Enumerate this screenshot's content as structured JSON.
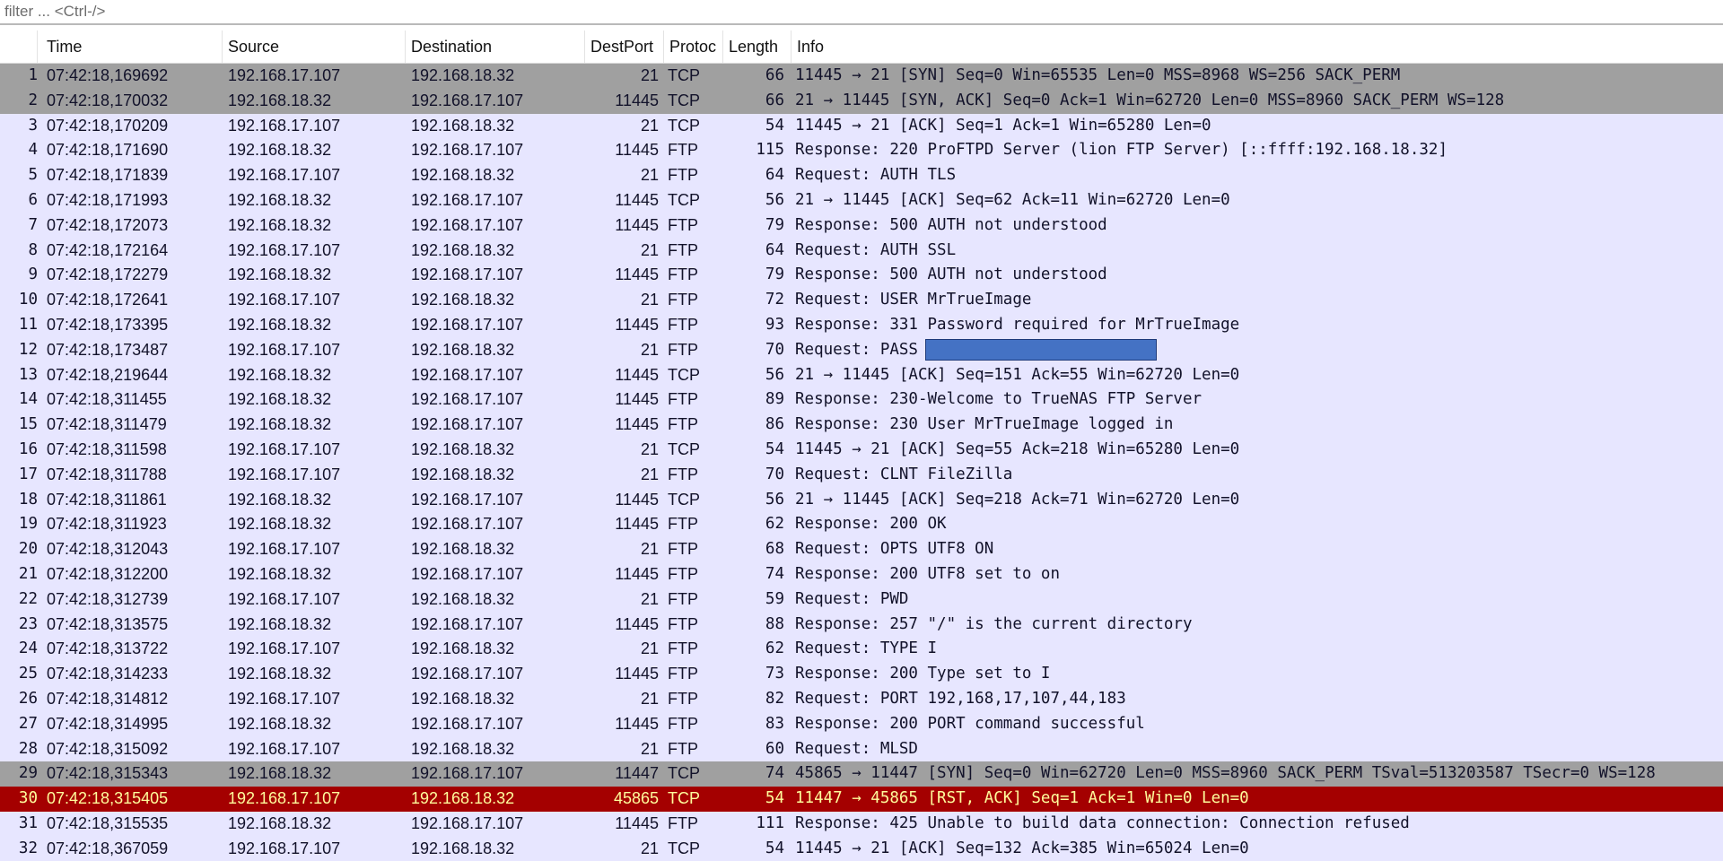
{
  "filter": {
    "placeholder": "filter ... <Ctrl-/>"
  },
  "columns": {
    "no": "",
    "time": "Time",
    "source": "Source",
    "destination": "Destination",
    "destport": "DestPort",
    "protocol": "Protoc",
    "length": "Length",
    "info": "Info"
  },
  "colors": {
    "tcp_ftp_row": "#e7e6ff",
    "syn_row": "#a0a0a0",
    "rst_row": "#a40000",
    "rst_text": "#fffc9c",
    "redaction": "#4472c4"
  },
  "rows": [
    {
      "no": "1",
      "time": "07:42:18,169692",
      "src": "192.168.17.107",
      "dst": "192.168.18.32",
      "dport": "21",
      "proto": "TCP",
      "len": "66",
      "info": "11445 → 21 [SYN] Seq=0 Win=65535 Len=0 MSS=8968 WS=256 SACK_PERM",
      "style": "syn"
    },
    {
      "no": "2",
      "time": "07:42:18,170032",
      "src": "192.168.18.32",
      "dst": "192.168.17.107",
      "dport": "11445",
      "proto": "TCP",
      "len": "66",
      "info": "21 → 11445 [SYN, ACK] Seq=0 Ack=1 Win=62720 Len=0 MSS=8960 SACK_PERM WS=128",
      "style": "syn"
    },
    {
      "no": "3",
      "time": "07:42:18,170209",
      "src": "192.168.17.107",
      "dst": "192.168.18.32",
      "dport": "21",
      "proto": "TCP",
      "len": "54",
      "info": "11445 → 21 [ACK] Seq=1 Ack=1 Win=65280 Len=0",
      "style": "tcp"
    },
    {
      "no": "4",
      "time": "07:42:18,171690",
      "src": "192.168.18.32",
      "dst": "192.168.17.107",
      "dport": "11445",
      "proto": "FTP",
      "len": "115",
      "info": "Response: 220 ProFTPD Server (lion FTP Server) [::ffff:192.168.18.32]",
      "style": "ftp"
    },
    {
      "no": "5",
      "time": "07:42:18,171839",
      "src": "192.168.17.107",
      "dst": "192.168.18.32",
      "dport": "21",
      "proto": "FTP",
      "len": "64",
      "info": "Request: AUTH TLS",
      "style": "ftp"
    },
    {
      "no": "6",
      "time": "07:42:18,171993",
      "src": "192.168.18.32",
      "dst": "192.168.17.107",
      "dport": "11445",
      "proto": "TCP",
      "len": "56",
      "info": "21 → 11445 [ACK] Seq=62 Ack=11 Win=62720 Len=0",
      "style": "tcp"
    },
    {
      "no": "7",
      "time": "07:42:18,172073",
      "src": "192.168.18.32",
      "dst": "192.168.17.107",
      "dport": "11445",
      "proto": "FTP",
      "len": "79",
      "info": "Response: 500 AUTH not understood",
      "style": "ftp"
    },
    {
      "no": "8",
      "time": "07:42:18,172164",
      "src": "192.168.17.107",
      "dst": "192.168.18.32",
      "dport": "21",
      "proto": "FTP",
      "len": "64",
      "info": "Request: AUTH SSL",
      "style": "ftp"
    },
    {
      "no": "9",
      "time": "07:42:18,172279",
      "src": "192.168.18.32",
      "dst": "192.168.17.107",
      "dport": "11445",
      "proto": "FTP",
      "len": "79",
      "info": "Response: 500 AUTH not understood",
      "style": "ftp"
    },
    {
      "no": "10",
      "time": "07:42:18,172641",
      "src": "192.168.17.107",
      "dst": "192.168.18.32",
      "dport": "21",
      "proto": "FTP",
      "len": "72",
      "info": "Request: USER MrTrueImage",
      "style": "ftp"
    },
    {
      "no": "11",
      "time": "07:42:18,173395",
      "src": "192.168.18.32",
      "dst": "192.168.17.107",
      "dport": "11445",
      "proto": "FTP",
      "len": "93",
      "info": "Response: 331 Password required for MrTrueImage",
      "style": "ftp"
    },
    {
      "no": "12",
      "time": "07:42:18,173487",
      "src": "192.168.17.107",
      "dst": "192.168.18.32",
      "dport": "21",
      "proto": "FTP",
      "len": "70",
      "info": "Request: PASS",
      "style": "ftp",
      "redacted": true
    },
    {
      "no": "13",
      "time": "07:42:18,219644",
      "src": "192.168.18.32",
      "dst": "192.168.17.107",
      "dport": "11445",
      "proto": "TCP",
      "len": "56",
      "info": "21 → 11445 [ACK] Seq=151 Ack=55 Win=62720 Len=0",
      "style": "tcp"
    },
    {
      "no": "14",
      "time": "07:42:18,311455",
      "src": "192.168.18.32",
      "dst": "192.168.17.107",
      "dport": "11445",
      "proto": "FTP",
      "len": "89",
      "info": "Response: 230-Welcome to TrueNAS FTP Server",
      "style": "ftp"
    },
    {
      "no": "15",
      "time": "07:42:18,311479",
      "src": "192.168.18.32",
      "dst": "192.168.17.107",
      "dport": "11445",
      "proto": "FTP",
      "len": "86",
      "info": "Response: 230 User MrTrueImage logged in",
      "style": "ftp"
    },
    {
      "no": "16",
      "time": "07:42:18,311598",
      "src": "192.168.17.107",
      "dst": "192.168.18.32",
      "dport": "21",
      "proto": "TCP",
      "len": "54",
      "info": "11445 → 21 [ACK] Seq=55 Ack=218 Win=65280 Len=0",
      "style": "tcp"
    },
    {
      "no": "17",
      "time": "07:42:18,311788",
      "src": "192.168.17.107",
      "dst": "192.168.18.32",
      "dport": "21",
      "proto": "FTP",
      "len": "70",
      "info": "Request: CLNT FileZilla",
      "style": "ftp"
    },
    {
      "no": "18",
      "time": "07:42:18,311861",
      "src": "192.168.18.32",
      "dst": "192.168.17.107",
      "dport": "11445",
      "proto": "TCP",
      "len": "56",
      "info": "21 → 11445 [ACK] Seq=218 Ack=71 Win=62720 Len=0",
      "style": "tcp"
    },
    {
      "no": "19",
      "time": "07:42:18,311923",
      "src": "192.168.18.32",
      "dst": "192.168.17.107",
      "dport": "11445",
      "proto": "FTP",
      "len": "62",
      "info": "Response: 200 OK",
      "style": "ftp"
    },
    {
      "no": "20",
      "time": "07:42:18,312043",
      "src": "192.168.17.107",
      "dst": "192.168.18.32",
      "dport": "21",
      "proto": "FTP",
      "len": "68",
      "info": "Request: OPTS UTF8 ON",
      "style": "ftp"
    },
    {
      "no": "21",
      "time": "07:42:18,312200",
      "src": "192.168.18.32",
      "dst": "192.168.17.107",
      "dport": "11445",
      "proto": "FTP",
      "len": "74",
      "info": "Response: 200 UTF8 set to on",
      "style": "ftp"
    },
    {
      "no": "22",
      "time": "07:42:18,312739",
      "src": "192.168.17.107",
      "dst": "192.168.18.32",
      "dport": "21",
      "proto": "FTP",
      "len": "59",
      "info": "Request: PWD",
      "style": "ftp"
    },
    {
      "no": "23",
      "time": "07:42:18,313575",
      "src": "192.168.18.32",
      "dst": "192.168.17.107",
      "dport": "11445",
      "proto": "FTP",
      "len": "88",
      "info": "Response: 257 \"/\" is the current directory",
      "style": "ftp"
    },
    {
      "no": "24",
      "time": "07:42:18,313722",
      "src": "192.168.17.107",
      "dst": "192.168.18.32",
      "dport": "21",
      "proto": "FTP",
      "len": "62",
      "info": "Request: TYPE I",
      "style": "ftp"
    },
    {
      "no": "25",
      "time": "07:42:18,314233",
      "src": "192.168.18.32",
      "dst": "192.168.17.107",
      "dport": "11445",
      "proto": "FTP",
      "len": "73",
      "info": "Response: 200 Type set to I",
      "style": "ftp"
    },
    {
      "no": "26",
      "time": "07:42:18,314812",
      "src": "192.168.17.107",
      "dst": "192.168.18.32",
      "dport": "21",
      "proto": "FTP",
      "len": "82",
      "info": "Request: PORT 192,168,17,107,44,183",
      "style": "ftp"
    },
    {
      "no": "27",
      "time": "07:42:18,314995",
      "src": "192.168.18.32",
      "dst": "192.168.17.107",
      "dport": "11445",
      "proto": "FTP",
      "len": "83",
      "info": "Response: 200 PORT command successful",
      "style": "ftp"
    },
    {
      "no": "28",
      "time": "07:42:18,315092",
      "src": "192.168.17.107",
      "dst": "192.168.18.32",
      "dport": "21",
      "proto": "FTP",
      "len": "60",
      "info": "Request: MLSD",
      "style": "ftp"
    },
    {
      "no": "29",
      "time": "07:42:18,315343",
      "src": "192.168.18.32",
      "dst": "192.168.17.107",
      "dport": "11447",
      "proto": "TCP",
      "len": "74",
      "info": "45865 → 11447 [SYN] Seq=0 Win=62720 Len=0 MSS=8960 SACK_PERM TSval=513203587 TSecr=0 WS=128",
      "style": "syn"
    },
    {
      "no": "30",
      "time": "07:42:18,315405",
      "src": "192.168.17.107",
      "dst": "192.168.18.32",
      "dport": "45865",
      "proto": "TCP",
      "len": "54",
      "info": "11447 → 45865 [RST, ACK] Seq=1 Ack=1 Win=0 Len=0",
      "style": "rst"
    },
    {
      "no": "31",
      "time": "07:42:18,315535",
      "src": "192.168.18.32",
      "dst": "192.168.17.107",
      "dport": "11445",
      "proto": "FTP",
      "len": "111",
      "info": "Response: 425 Unable to build data connection: Connection refused",
      "style": "ftp"
    },
    {
      "no": "32",
      "time": "07:42:18,367059",
      "src": "192.168.17.107",
      "dst": "192.168.18.32",
      "dport": "21",
      "proto": "TCP",
      "len": "54",
      "info": "11445 → 21 [ACK] Seq=132 Ack=385 Win=65024 Len=0",
      "style": "tcp"
    }
  ]
}
